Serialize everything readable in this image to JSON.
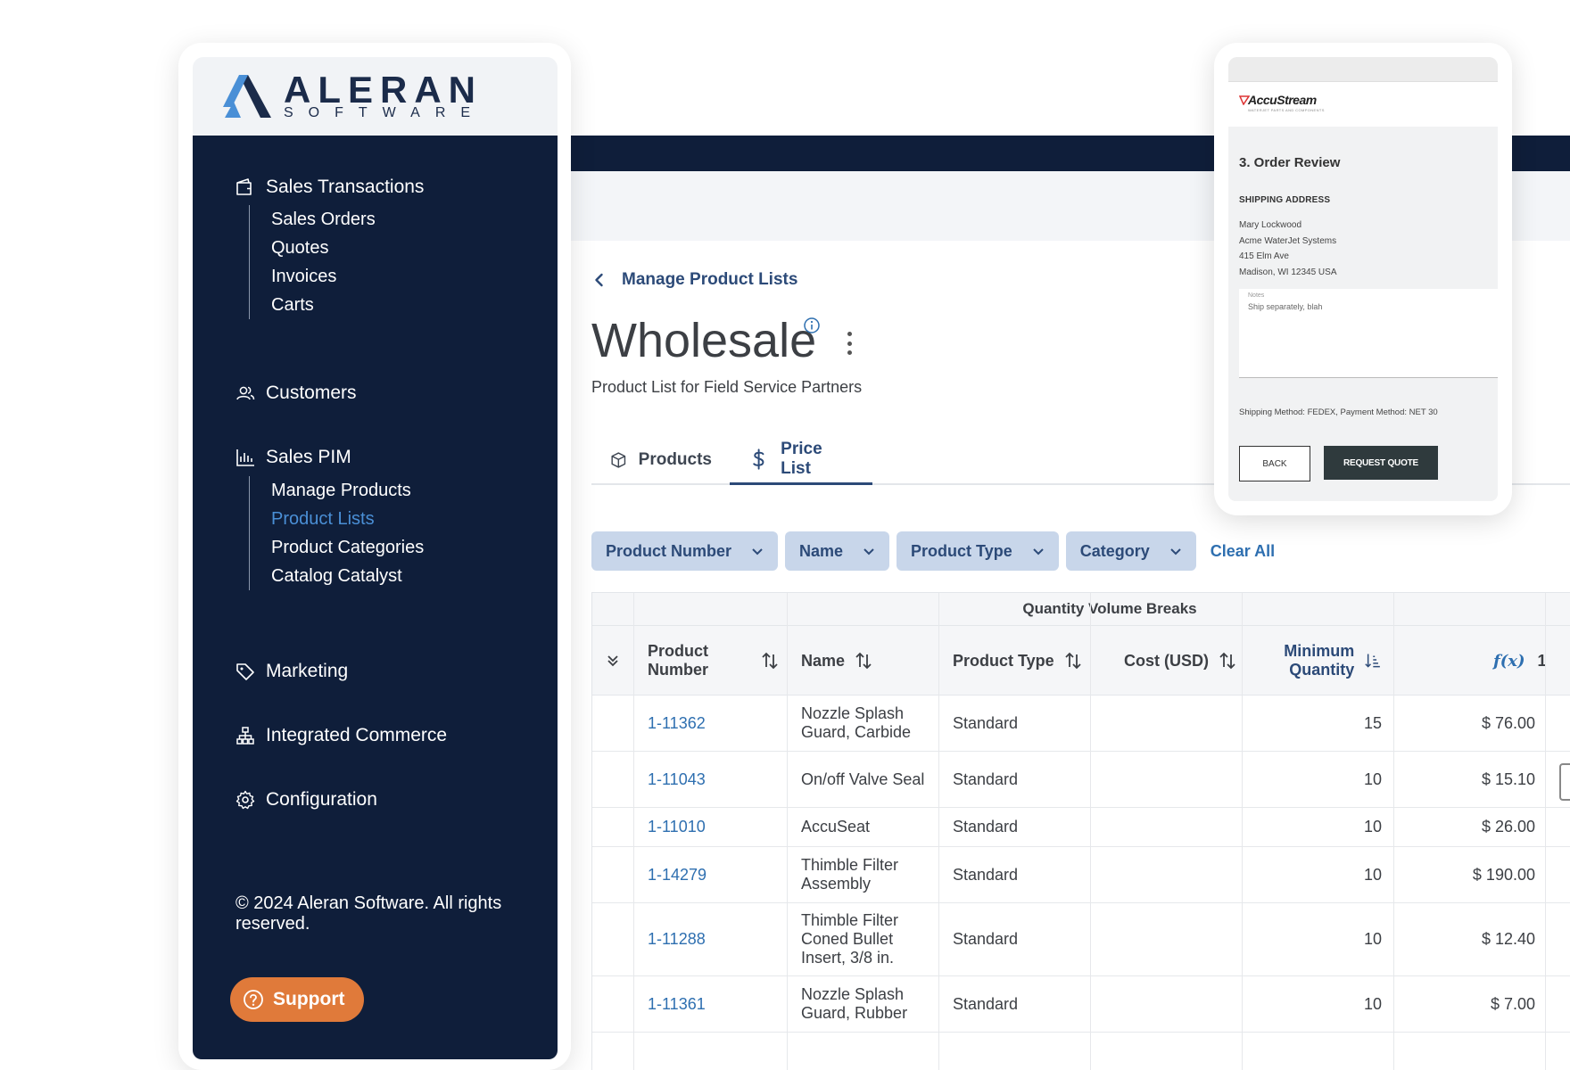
{
  "brand": {
    "logo_word": "ALERAN",
    "logo_sub": "SOFTWARE"
  },
  "sidebar": {
    "sections": [
      {
        "label": "Sales Transactions",
        "icon": "wallet-icon"
      },
      {
        "label": "Customers",
        "icon": "users-icon"
      },
      {
        "label": "Sales PIM",
        "icon": "bar-chart-icon"
      },
      {
        "label": "Marketing",
        "icon": "tag-icon"
      },
      {
        "label": "Integrated Commerce",
        "icon": "network-icon"
      },
      {
        "label": "Configuration",
        "icon": "gear-icon"
      }
    ],
    "sales_transactions_items": [
      "Sales Orders",
      "Quotes",
      "Invoices",
      "Carts"
    ],
    "sales_pim_items": [
      "Manage Products",
      "Product Lists",
      "Product Categories",
      "Catalog Catalyst"
    ],
    "active_item": "Product Lists",
    "copyright": "© 2024 Aleran Software. All rights reserved.",
    "support_label": "Support",
    "colors": {
      "nav_bg": "#0f1e3a",
      "active": "#4a8fd6",
      "support": "#e07a3a"
    }
  },
  "main": {
    "breadcrumb": "Manage Product Lists",
    "title": "Wholesale",
    "subtitle": "Product List for Field Service Partners",
    "tabs": [
      {
        "label": "Products",
        "icon": "box-icon"
      },
      {
        "label": "Price List",
        "icon": "dollar-icon"
      }
    ],
    "active_tab": "Price List",
    "filters": [
      "Product Number",
      "Name",
      "Product Type",
      "Category"
    ],
    "clear_all": "Clear All"
  },
  "table": {
    "group_header": "Quantity Volume Breaks",
    "columns": {
      "product_number": "Product Number",
      "name": "Name",
      "product_type": "Product Type",
      "cost": "Cost (USD)",
      "min_qty": "Minimum Quantity",
      "fx_symbol": "f(x)",
      "fx_count": "1"
    },
    "rows": [
      {
        "product_number": "1-11362",
        "name": "Nozzle Splash Guard, Carbide",
        "product_type": "Standard",
        "cost": "",
        "min_qty": "15",
        "price": "$ 76.00"
      },
      {
        "product_number": "1-11043",
        "name": "On/off Valve Seal",
        "product_type": "Standard",
        "cost": "",
        "min_qty": "10",
        "price": "$ 15.10"
      },
      {
        "product_number": "1-11010",
        "name": "AccuSeat",
        "product_type": "Standard",
        "cost": "",
        "min_qty": "10",
        "price": "$ 26.00"
      },
      {
        "product_number": "1-14279",
        "name": "Thimble Filter Assembly",
        "product_type": "Standard",
        "cost": "",
        "min_qty": "10",
        "price": "$ 190.00"
      },
      {
        "product_number": "1-11288",
        "name": "Thimble Filter Coned Bullet Insert, 3/8 in.",
        "product_type": "Standard",
        "cost": "",
        "min_qty": "10",
        "price": "$ 12.40"
      },
      {
        "product_number": "1-11361",
        "name": "Nozzle Splash Guard, Rubber",
        "product_type": "Standard",
        "cost": "",
        "min_qty": "10",
        "price": "$ 7.00"
      }
    ]
  },
  "phone": {
    "logo": "AccuStream",
    "tagline": "WATERJET PARTS AND COMPONENTS",
    "step": "3. Order Review",
    "shipping_label": "SHIPPING ADDRESS",
    "address": [
      "Mary Lockwood",
      "Acme WaterJet Systems",
      "415 Elm Ave",
      "Madison, WI 12345 USA"
    ],
    "notes_label": "Notes",
    "notes_value": "Ship separately, blah",
    "methods": "Shipping Method: FEDEX, Payment Method: NET 30",
    "back_label": "BACK",
    "request_label": "REQUEST QUOTE"
  }
}
